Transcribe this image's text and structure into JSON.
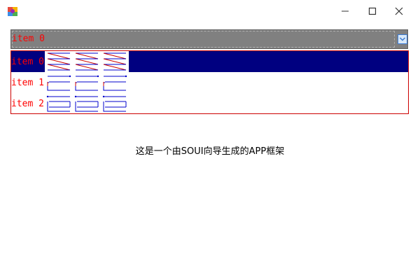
{
  "window": {
    "icon": "colorful-app-icon",
    "controls": {
      "minimize_icon": "minimize-icon",
      "maximize_icon": "maximize-icon",
      "close_icon": "close-icon"
    }
  },
  "combobox": {
    "selected_text": "item 0",
    "dropdown_icon": "dropdown-arrow-icon"
  },
  "dropdown": {
    "items": [
      {
        "label": "item 0",
        "selected": true,
        "icon_style": "zigzag-icon"
      },
      {
        "label": "item 1",
        "selected": false,
        "icon_style": "bracket-icon"
      },
      {
        "label": "item 2",
        "selected": false,
        "icon_style": "bracket-icon"
      }
    ]
  },
  "main": {
    "message": "这是一个由SOUI向导生成的APP框架"
  },
  "colors": {
    "item_text": "#ff0000",
    "selected_bg": "#000080",
    "header_bg": "#808080",
    "list_border": "#cc0000",
    "icon_blue": "#0000cc",
    "icon_red": "#cc0000"
  }
}
